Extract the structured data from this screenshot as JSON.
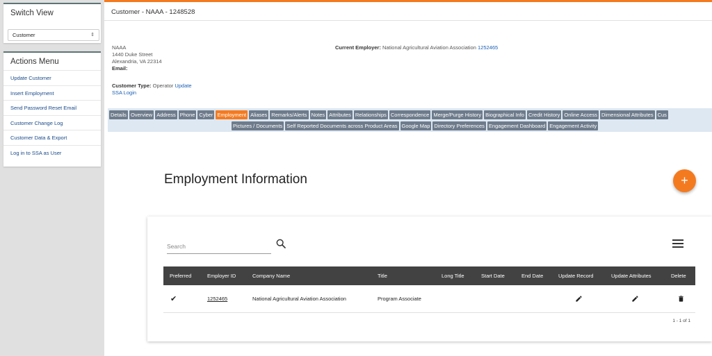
{
  "sidebar": {
    "switch_view": {
      "title": "Switch View",
      "selected": "Customer"
    },
    "actions": {
      "title": "Actions Menu",
      "items": [
        "Update Customer",
        "Insert Employment",
        "Send Password Reset Email",
        "Customer Change Log",
        "Customer Data & Export",
        "Log in to SSA as User"
      ]
    }
  },
  "header": {
    "title": "Customer - NAAA - 1248528"
  },
  "customer": {
    "name": "NAAA",
    "street": "1440 Duke Street",
    "city": "Alexandria, VA 22314",
    "email_label": "Email:",
    "employer_label": "Current Employer:",
    "employer_name": "National Agricultural Aviation Association",
    "employer_id": "1252465",
    "type_label": "Customer Type:",
    "type_value": "Operator",
    "update_link": "Update",
    "ssa_login": "SSA Login"
  },
  "tabs": {
    "row1": [
      "Details",
      "Overview",
      "Address",
      "Phone",
      "Cyber",
      "Employment",
      "Aliases",
      "Remarks/Alerts",
      "Notes",
      "Attributes",
      "Relationships",
      "Correspondence",
      "Merge/Purge History",
      "Biographical Info",
      "Credit History",
      "Online Access",
      "Dimensional Attributes",
      "Cus"
    ],
    "row2": [
      "Pictures / Documents",
      "Self Reported Documents across Product Areas",
      "Google Map",
      "Directory Preferences",
      "Engagement Dashboard",
      "Engagement Activity"
    ],
    "active": "Employment"
  },
  "employment": {
    "title": "Employment Information",
    "add_label": "+",
    "search_placeholder": "Search",
    "columns": [
      "Preferred",
      "Employer ID",
      "Company Name",
      "Title",
      "Long Title",
      "Start Date",
      "End Date",
      "Update Record",
      "Update Attributes",
      "Delete"
    ],
    "rows": [
      {
        "preferred": "✔",
        "employer_id": "1252465",
        "company_name": "National Agricultural Aviation Association",
        "title": "Program Associate",
        "long_title": "",
        "start_date": "",
        "end_date": ""
      }
    ],
    "pagination": "1 - 1 of 1"
  },
  "icons": {
    "search": "search-icon",
    "menu": "menu-icon",
    "edit": "pencil-icon",
    "delete": "trash-icon",
    "select_arrow": "sort-arrows-icon"
  },
  "colors": {
    "accent": "#f47a20",
    "tab": "#6e7b8b",
    "table_header": "#424242",
    "link": "#1a5fb4"
  }
}
